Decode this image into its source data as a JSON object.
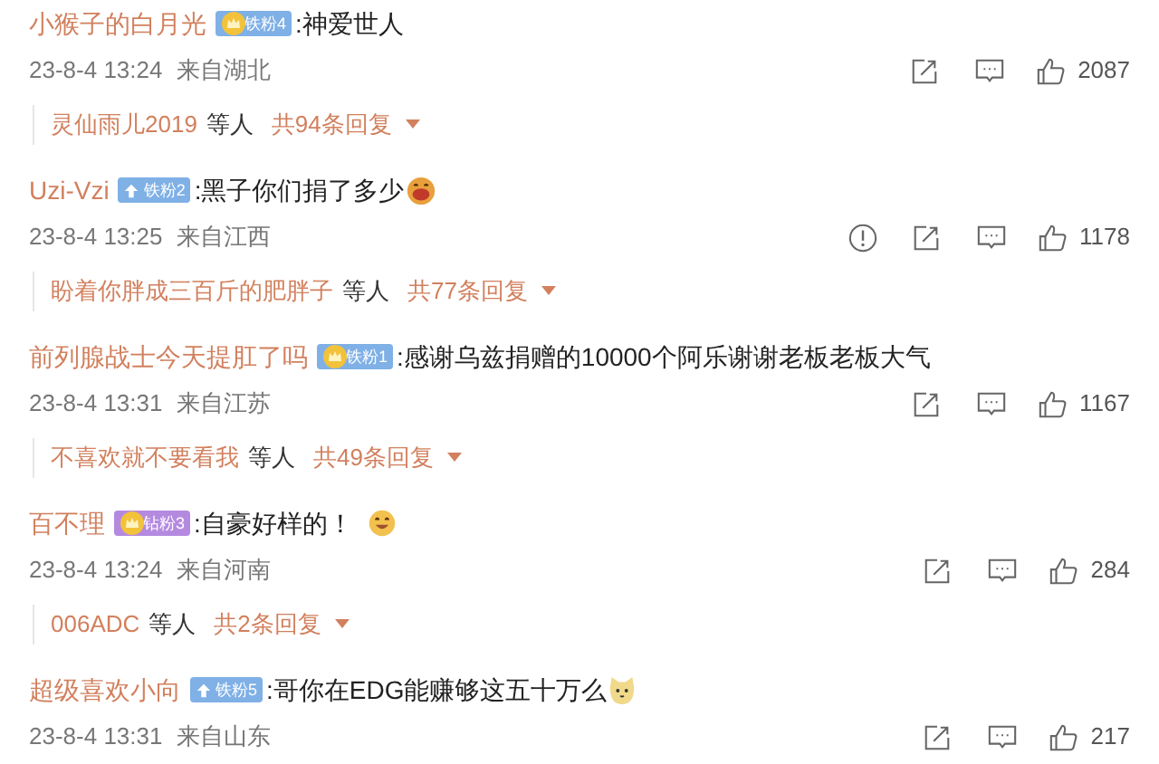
{
  "comments": [
    {
      "name": "小猴子的白月光",
      "badge": {
        "label": "铁粉4",
        "color": "#7fb0e6"
      },
      "text": ":神爱世人",
      "time": "23-8-4 13:24",
      "location": "来自湖北",
      "report": false,
      "likes": "2087",
      "replies": {
        "from": "灵仙雨儿2019",
        "others": "等人",
        "count": "共94条回复"
      }
    },
    {
      "name": "Uzi-Vzi",
      "badge": {
        "label": "铁粉2",
        "color": "#7fb0e6"
      },
      "text": ":黑子你们捐了多少",
      "time": "23-8-4 13:25",
      "location": "来自江西",
      "report": true,
      "likes": "1178",
      "replies": {
        "from": "盼着你胖成三百斤的肥胖子",
        "others": "等人",
        "count": "共77条回复"
      }
    },
    {
      "name": "前列腺战士今天提肛了吗",
      "badge": {
        "label": "铁粉1",
        "color": "#7fb0e6"
      },
      "text": ":感谢乌兹捐赠的10000个阿乐谢谢老板老板大气",
      "time": "23-8-4 13:31",
      "location": "来自江苏",
      "report": false,
      "likes": "1167",
      "replies": {
        "from": "不喜欢就不要看我",
        "others": "等人",
        "count": "共49条回复"
      }
    },
    {
      "name": "百不理",
      "badge": {
        "label": "钻粉3",
        "color": "#b48ae0"
      },
      "text": ":自豪好样的！",
      "time": "23-8-4 13:24",
      "location": "来自河南",
      "report": false,
      "likes": "284",
      "replies": {
        "from": "006ADC",
        "others": "等人",
        "count": "共2条回复"
      }
    },
    {
      "name": "超级喜欢小向",
      "badge": {
        "label": "铁粉5",
        "color": "#7fb0e6"
      },
      "text": ":哥你在EDG能赚够这五十万么",
      "time": "23-8-4 13:31",
      "location": "来自山东",
      "report": false,
      "likes": "217"
    }
  ]
}
